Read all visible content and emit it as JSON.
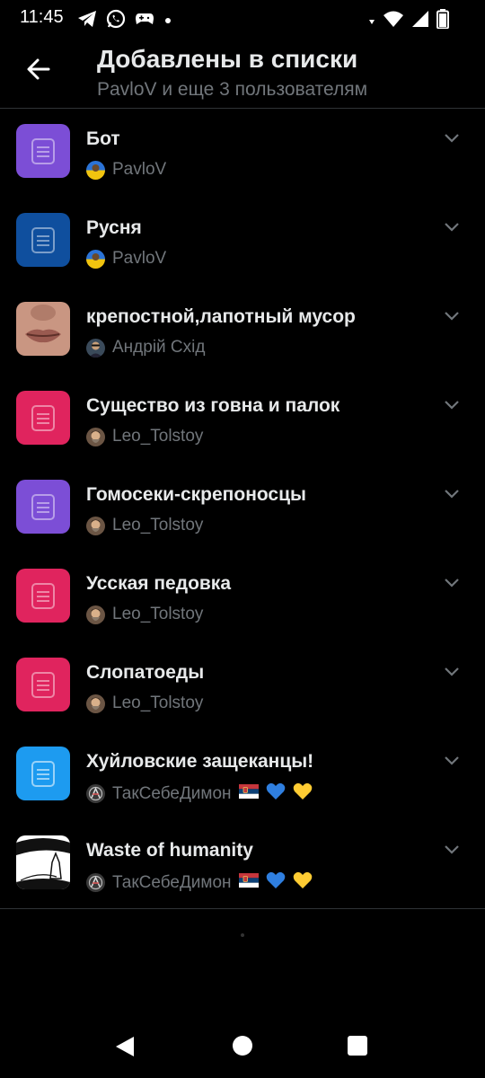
{
  "status_bar": {
    "time": "11:45",
    "left_icons": [
      "telegram-icon",
      "whatsapp-icon",
      "gamepad-icon",
      "dot-icon"
    ],
    "right_icons": [
      "data-arrows-icon",
      "wifi-icon",
      "signal-icon",
      "battery-icon"
    ]
  },
  "header": {
    "title": "Добавлены в списки",
    "subtitle": "PavloV и еще 3 пользователям"
  },
  "colors": {
    "purple": "#7c4ed6",
    "dark_blue": "#0f4f9e",
    "pink": "#e0245e",
    "sky_blue": "#1d9bf0"
  },
  "lists": [
    {
      "name": "Бот",
      "owner": "PavloV",
      "thumb": "purple",
      "avatar": "avatar-ua"
    },
    {
      "name": "Русня",
      "owner": "PavloV",
      "thumb": "dark_blue",
      "avatar": "avatar-ua"
    },
    {
      "name": "крепостной,лапотный мусор",
      "owner": "Андрій Схід",
      "thumb": "photo-lips",
      "avatar": "avatar-man"
    },
    {
      "name": "Существо из говна и палок",
      "owner": "Leo_Tolstoy",
      "thumb": "pink",
      "avatar": "avatar-portrait"
    },
    {
      "name": "Гомосеки-скрепоносцы",
      "owner": "Leo_Tolstoy",
      "thumb": "purple",
      "avatar": "avatar-portrait"
    },
    {
      "name": "Усская педовка",
      "owner": "Leo_Tolstoy",
      "thumb": "pink",
      "avatar": "avatar-portrait"
    },
    {
      "name": "Слопатоеды",
      "owner": "Leo_Tolstoy",
      "thumb": "pink",
      "avatar": "avatar-portrait"
    },
    {
      "name": "Хуйловские защеканцы!",
      "owner": "ТакСебеДимон",
      "thumb": "sky_blue",
      "avatar": "avatar-figure",
      "emoji": [
        "serbian-flag-icon",
        "blue-heart-icon",
        "yellow-heart-icon"
      ]
    },
    {
      "name": "Waste of humanity",
      "owner": "ТакСебеДимон",
      "thumb": "photo-drawing",
      "avatar": "avatar-figure",
      "emoji": [
        "serbian-flag-icon",
        "blue-heart-icon",
        "yellow-heart-icon"
      ]
    }
  ]
}
